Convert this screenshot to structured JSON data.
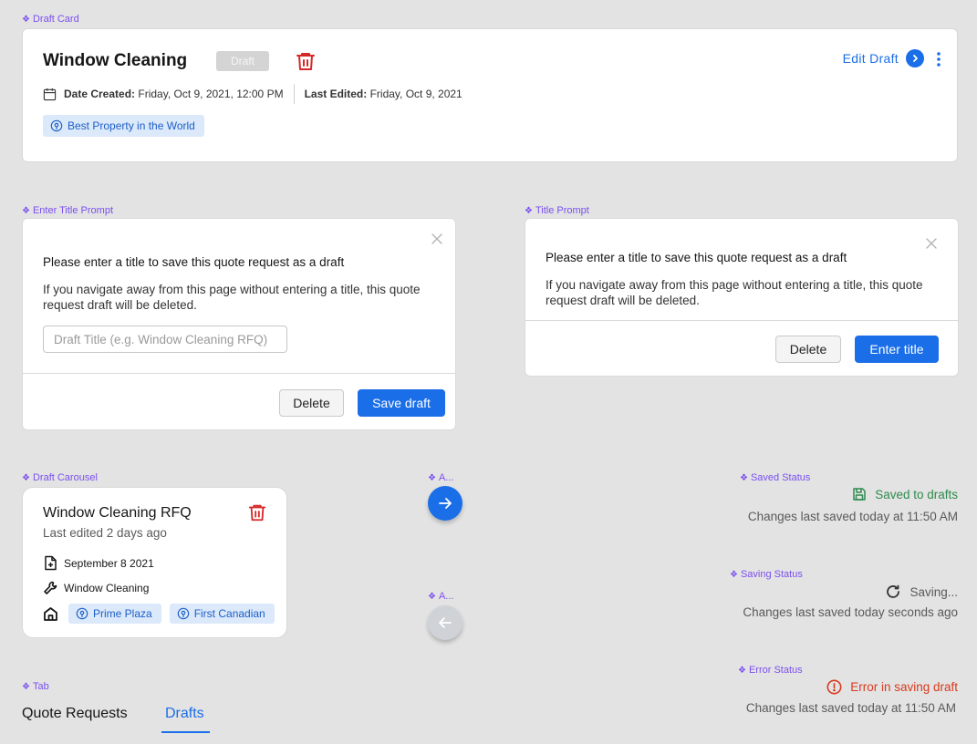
{
  "frames": {
    "draft_card": "Draft Card",
    "enter_title_prompt": "Enter Title Prompt",
    "title_prompt": "Title Prompt",
    "draft_carousel": "Draft Carousel",
    "arrow_next": "A...",
    "arrow_prev": "A...",
    "saved_status": "Saved Status",
    "saving_status": "Saving Status",
    "error_status": "Error Status",
    "tab": "Tab"
  },
  "draft_card": {
    "title": "Window Cleaning",
    "badge": "Draft",
    "date_created_label": "Date Created:",
    "date_created_value": "Friday, Oct 9, 2021, 12:00 PM",
    "last_edited_label": "Last Edited:",
    "last_edited_value": "Friday, Oct 9, 2021",
    "property_chip": "Best Property in the World",
    "edit_label": "Edit Draft"
  },
  "enter_title_prompt": {
    "heading": "Please enter a title to save this quote request as a draft",
    "body": "If you navigate away from this page without entering a title, this quote request draft will be deleted.",
    "input_placeholder": "Draft Title (e.g. Window Cleaning RFQ)",
    "delete_label": "Delete",
    "save_label": "Save draft"
  },
  "title_prompt": {
    "heading": "Please enter a title to save this quote request as a draft",
    "body": "If you navigate away from this page without entering a title, this quote request draft will be deleted.",
    "delete_label": "Delete",
    "enter_label": "Enter title"
  },
  "draft_carousel": {
    "title": "Window Cleaning RFQ",
    "subtitle": "Last edited 2 days ago",
    "date": "September 8 2021",
    "service": "Window Cleaning",
    "chips": [
      "Prime Plaza",
      "First Canadian"
    ]
  },
  "saved_status": {
    "label": "Saved to drafts",
    "sub": "Changes last saved today at 11:50 AM",
    "color": "#2e8b4e"
  },
  "saving_status": {
    "label": "Saving...",
    "sub": "Changes last saved today seconds ago",
    "color": "#5a5a5a"
  },
  "error_status": {
    "label": "Error in saving draft",
    "sub": "Changes last saved today at 11:50 AM",
    "color": "#d83a1e"
  },
  "tabs": {
    "items": [
      {
        "label": "Quote Requests",
        "active": false
      },
      {
        "label": "Drafts",
        "active": true
      }
    ]
  },
  "colors": {
    "accent": "#1a6ee8",
    "danger": "#d62828",
    "frame_label": "#7b4ff0",
    "chip_bg": "#dbe9fb"
  },
  "icons": {
    "trash": "trash-icon",
    "calendar": "calendar-icon",
    "location": "location-pin-icon",
    "chevron": "chevron-right-icon",
    "more": "more-vertical-icon",
    "close": "close-icon",
    "file": "file-plus-icon",
    "wrench": "wrench-icon",
    "building": "building-icon",
    "arrow_right": "arrow-right-icon",
    "arrow_left": "arrow-left-icon",
    "save": "floppy-disk-icon",
    "refresh": "refresh-icon",
    "error": "alert-circle-icon"
  }
}
